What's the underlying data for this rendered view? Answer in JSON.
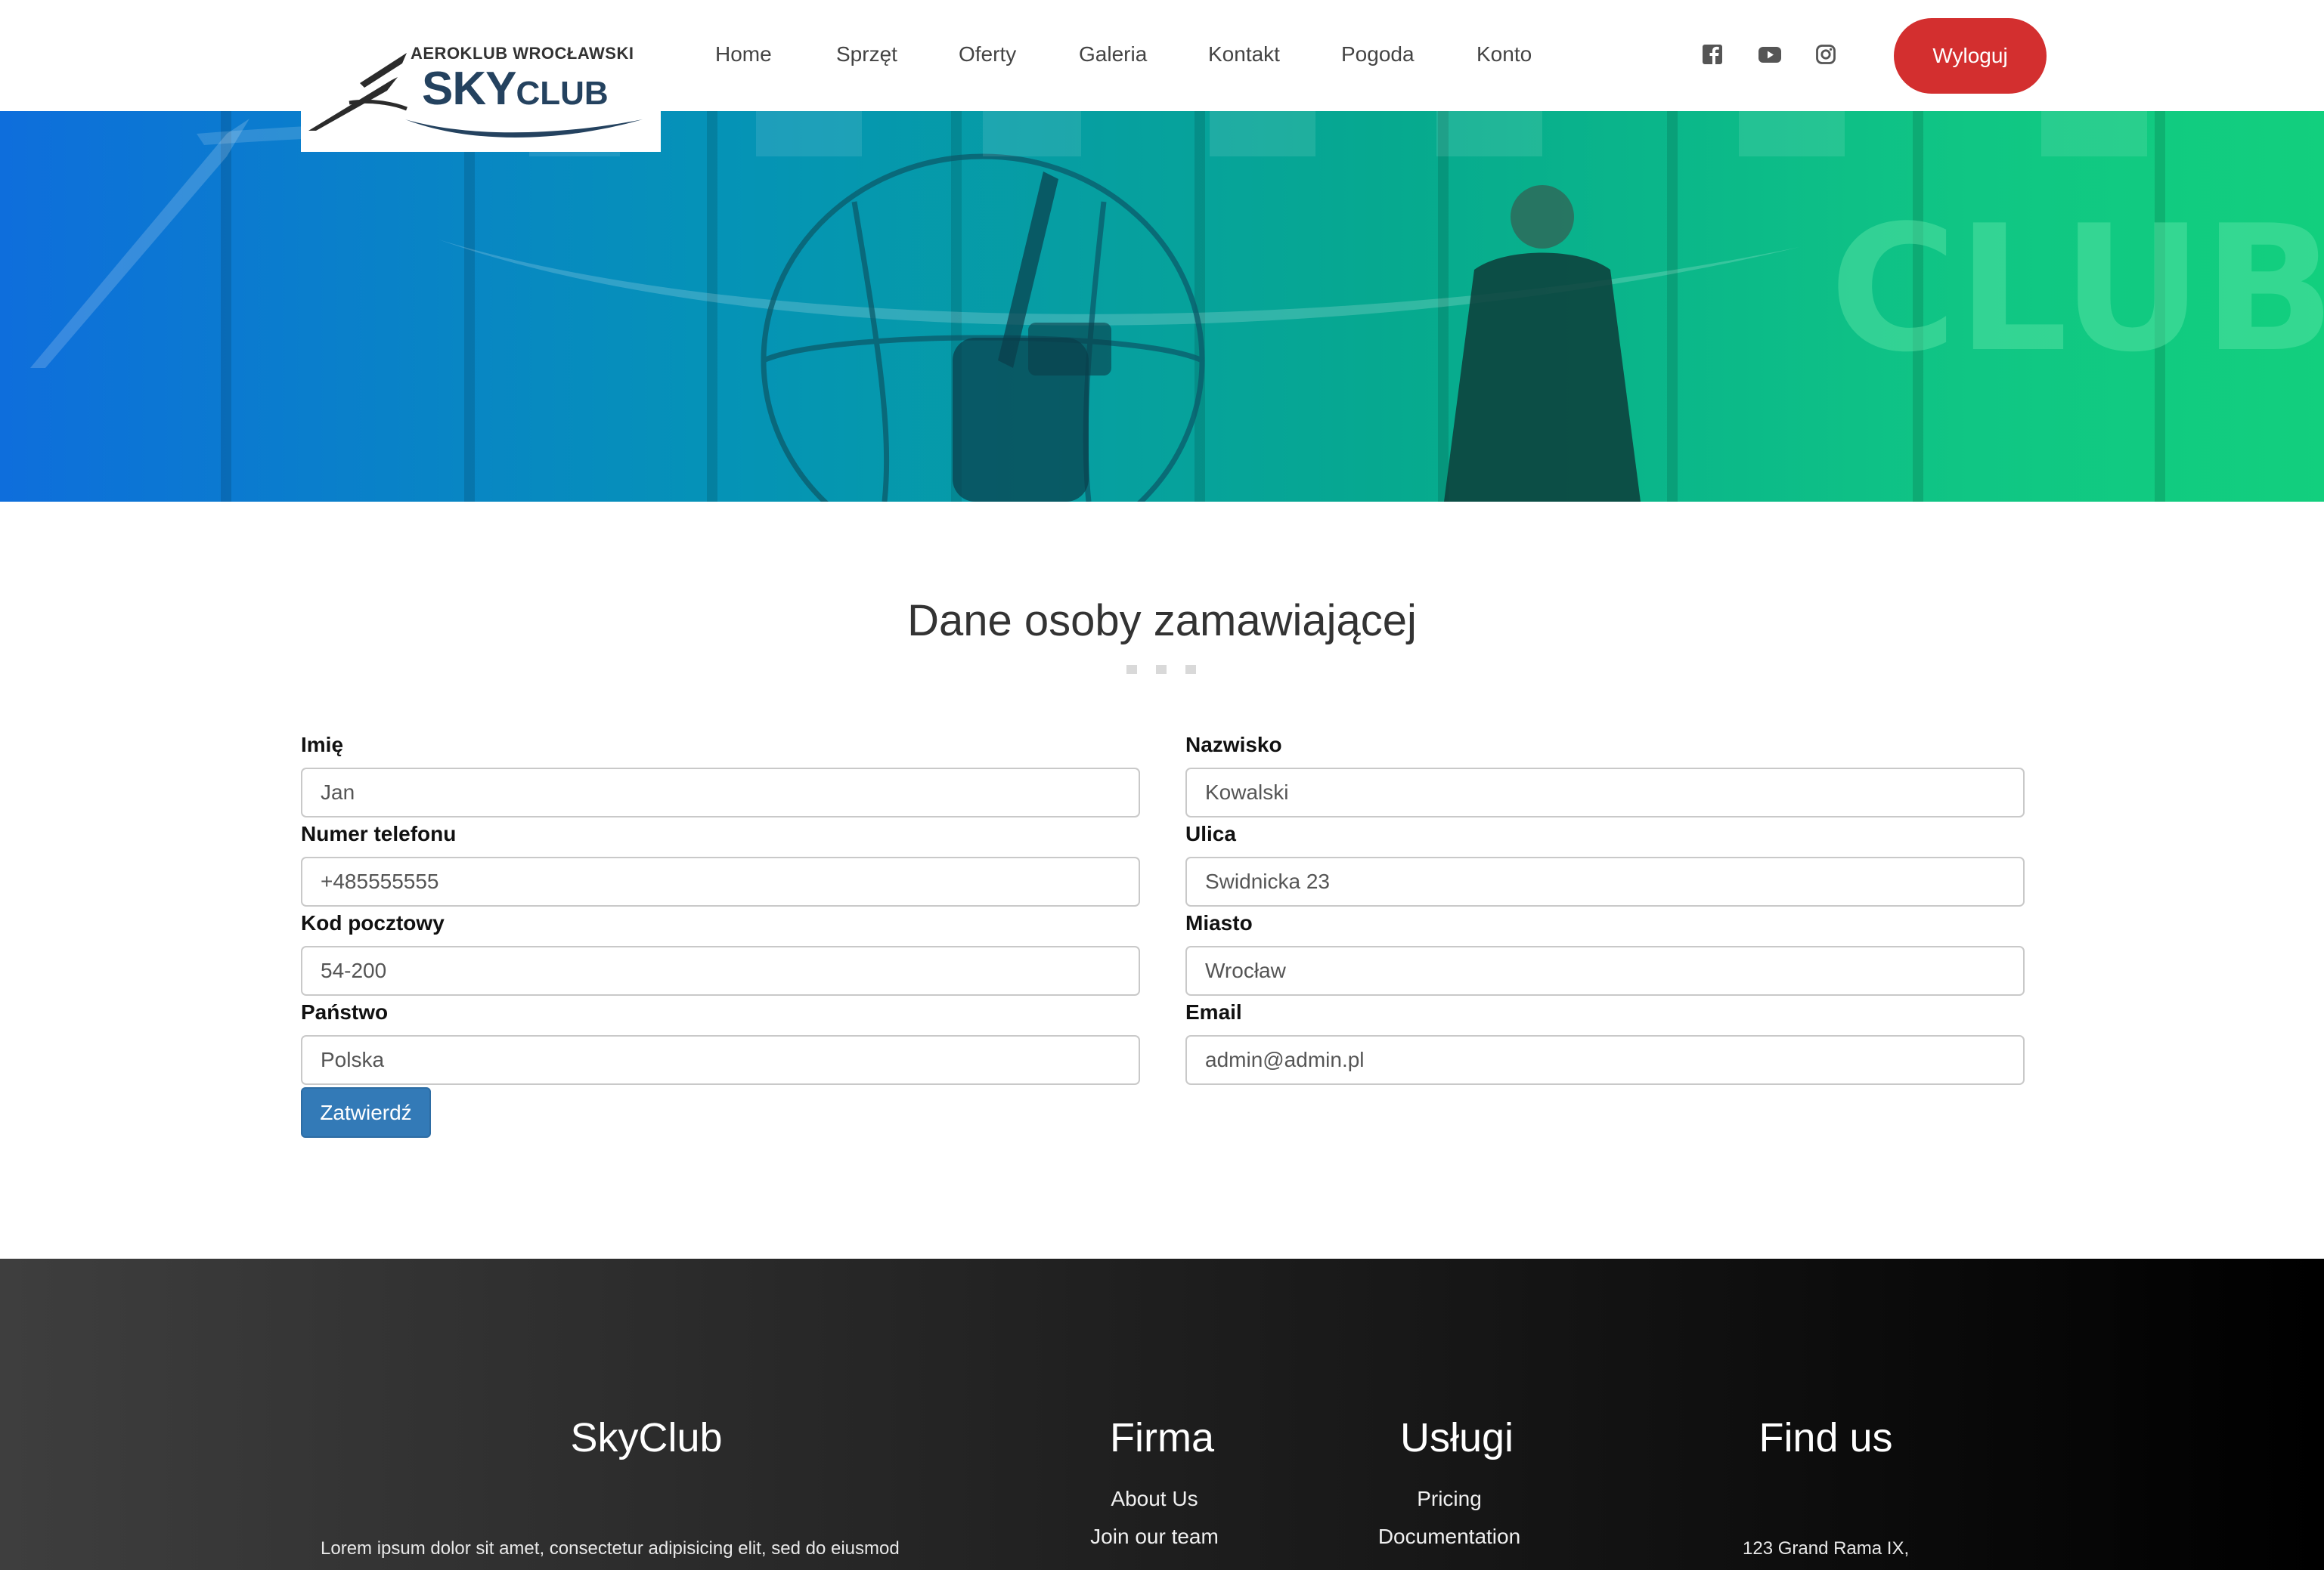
{
  "brand": {
    "small_text": "AEROKLUB WROCŁAWSKI",
    "big_text_sky": "SKY",
    "big_text_club": "CLUB"
  },
  "nav": {
    "items": [
      {
        "label": "Home"
      },
      {
        "label": "Sprzęt"
      },
      {
        "label": "Oferty"
      },
      {
        "label": "Galeria"
      },
      {
        "label": "Kontakt"
      },
      {
        "label": "Pogoda"
      },
      {
        "label": "Konto"
      }
    ],
    "social": [
      "facebook-icon",
      "youtube-icon",
      "instagram-icon"
    ],
    "logout_label": "Wyloguj"
  },
  "hero": {
    "banner_text": "CLUB"
  },
  "form": {
    "title": "Dane osoby zamawiającej",
    "fields": {
      "first_name": {
        "label": "Imię",
        "value": "Jan"
      },
      "last_name": {
        "label": "Nazwisko",
        "value": "Kowalski"
      },
      "phone": {
        "label": "Numer telefonu",
        "value": "+485555555"
      },
      "street": {
        "label": "Ulica",
        "value": "Swidnicka 23"
      },
      "postal_code": {
        "label": "Kod pocztowy",
        "value": "54-200"
      },
      "city": {
        "label": "Miasto",
        "value": "Wrocław"
      },
      "country": {
        "label": "Państwo",
        "value": "Polska"
      },
      "email": {
        "label": "Email",
        "value": "admin@admin.pl"
      }
    },
    "submit_label": "Zatwierdź"
  },
  "footer": {
    "brand_heading": "SkyClub",
    "brand_text": "Lorem ipsum dolor sit amet, consectetur adipisicing elit, sed do eiusmod",
    "company": {
      "heading": "Firma",
      "links": [
        "About Us",
        "Join our team"
      ]
    },
    "services": {
      "heading": "Usługi",
      "links": [
        "Pricing",
        "Documentation"
      ]
    },
    "find_us": {
      "heading": "Find us",
      "address": "123 Grand Rama IX,"
    }
  },
  "colors": {
    "accent_red": "#d32f2f",
    "button_blue": "#337ab7",
    "logo_navy": "#24425f",
    "hero_gradient_start": "#0e6edc",
    "hero_gradient_end": "#12cf7e"
  }
}
